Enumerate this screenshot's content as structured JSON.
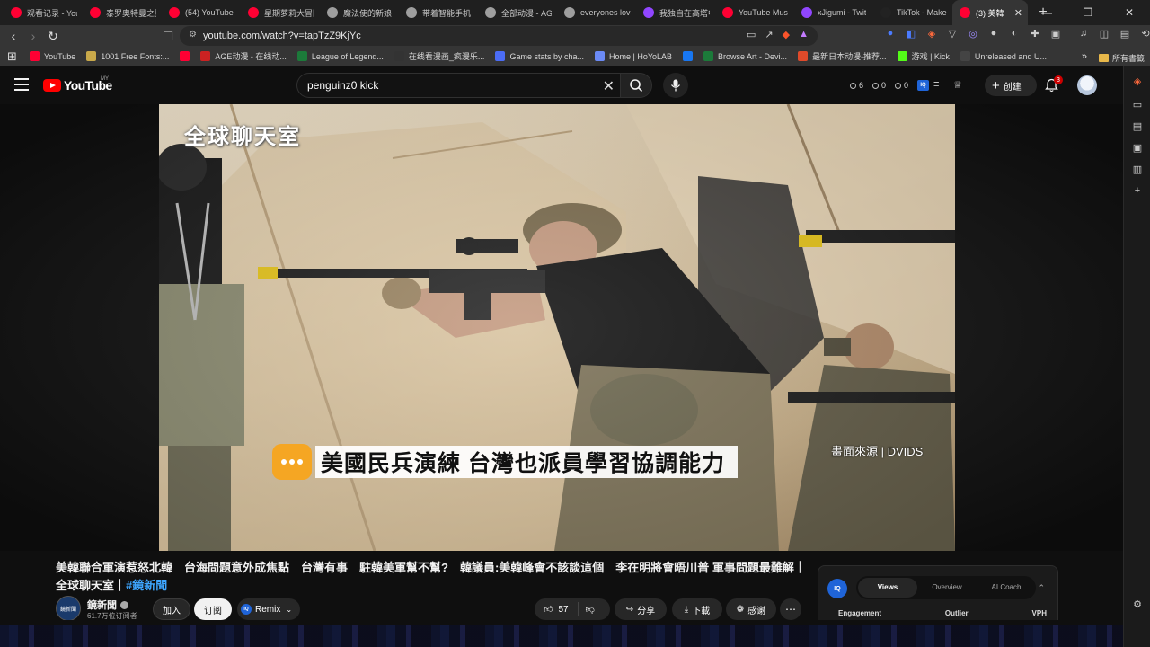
{
  "tabs": [
    {
      "label": "观看记录 - You",
      "color": "#ff0033"
    },
    {
      "label": "泰罗奥特曼之謎",
      "color": "#ff0033"
    },
    {
      "label": "(54) YouTube",
      "color": "#ff0033"
    },
    {
      "label": "星期萝莉大冒险",
      "color": "#ff0033"
    },
    {
      "label": "魔法使的新娘",
      "color": "#9e9e9e"
    },
    {
      "label": "带着智能手机",
      "color": "#9e9e9e"
    },
    {
      "label": "全部动漫 - AGE",
      "color": "#9e9e9e"
    },
    {
      "label": "everyones lov",
      "color": "#9e9e9e"
    },
    {
      "label": "我独自在高塔中",
      "color": "#9146ff"
    },
    {
      "label": "YouTube Mus",
      "color": "#ff0033"
    },
    {
      "label": "xJigumi - Twit",
      "color": "#9146ff"
    },
    {
      "label": "TikTok - Make",
      "color": "#222222"
    },
    {
      "label": "(3) 美韓",
      "color": "#ff0033",
      "active": true
    }
  ],
  "address": {
    "url": "youtube.com/watch?v=tapTzZ9KjYc"
  },
  "bookmarks": [
    {
      "label": "YouTube",
      "color": "#ff0033"
    },
    {
      "label": "1001 Free Fonts:...",
      "color": "#c9a94a"
    },
    {
      "label": "",
      "color": "#ff0033"
    },
    {
      "label": "AGE动漫 - 在线动...",
      "color": "#cc2222"
    },
    {
      "label": "League of Legend...",
      "color": "#1c7a3a"
    },
    {
      "label": "在线看漫画_疯漫乐...",
      "color": "#333333"
    },
    {
      "label": "Game stats by cha...",
      "color": "#4b6cf5"
    },
    {
      "label": "Home | HoYoLAB",
      "color": "#6b8af5"
    },
    {
      "label": "",
      "color": "#1877f2"
    },
    {
      "label": "Browse Art - Devi...",
      "color": "#1c7a3a"
    },
    {
      "label": "最新日本动漫-推荐...",
      "color": "#e04a2a"
    },
    {
      "label": "游戏 | Kick",
      "color": "#53fc18"
    },
    {
      "label": "Unreleased and U...",
      "color": "#444444"
    }
  ],
  "bookmarks_all": "所有書籤",
  "youtube": {
    "logo_text": "YouTube",
    "region": "MY",
    "search_value": "penguinz0 kick",
    "stats": [
      "6",
      "0",
      "0"
    ],
    "create_label": "创建",
    "notif_count": "3"
  },
  "video": {
    "watermark": "全球聊天室",
    "caption": "美國民兵演練 台灣也派員學習協調能力",
    "source": "畫面來源 | DVIDS"
  },
  "title": {
    "text": "美韓聯合軍演惹怒北韓　台海問題意外成焦點　台灣有事　駐韓美軍幫不幫?　韓議員:美韓峰會不該談這個　李在明將會晤川普 軍事問題最難解｜全球聊天室｜",
    "hashtag": "#鏡新聞"
  },
  "channel": {
    "name": "鏡新聞",
    "subs": "61.7万位订阅者",
    "avatar_text": "鏡新聞"
  },
  "actions": {
    "join": "加入",
    "subscribe": "订阅",
    "remix": "Remix",
    "likes": "57",
    "share": "分享",
    "download": "下載",
    "thanks": "感谢"
  },
  "vidiq": {
    "logo": "IQ",
    "tabs": [
      "Views",
      "Overview",
      "AI Coach"
    ],
    "metrics": [
      "Engagement",
      "Outlier",
      "VPH"
    ]
  },
  "colors": {
    "accent_red": "#ff0000",
    "link_blue": "#3ea6ff",
    "caption_orange": "#f5a623"
  }
}
